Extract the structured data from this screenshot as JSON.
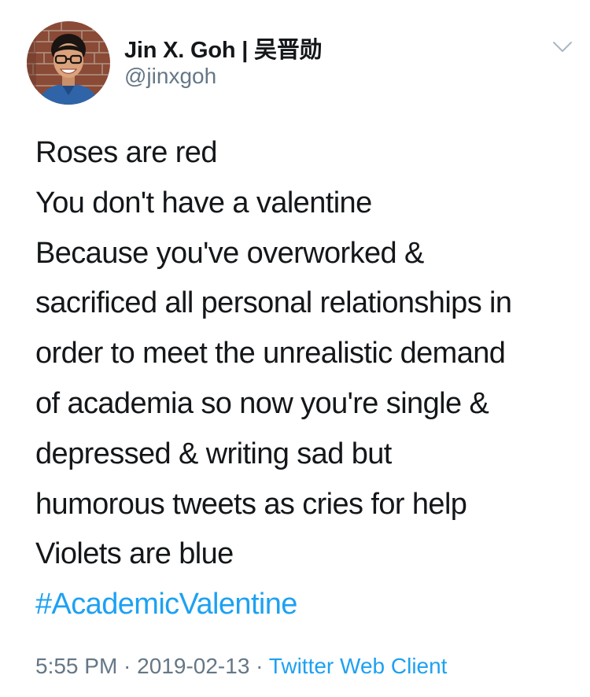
{
  "author": {
    "display_name": "Jin X. Goh | 吴晋勋",
    "handle": "@jinxgoh",
    "avatar_icon": "profile-photo"
  },
  "menu_icon": "chevron-down-icon",
  "tweet": {
    "lines": [
      "Roses are red",
      "You don't have a valentine",
      "Because you've overworked &",
      "sacrificed all personal relationships in",
      "order to meet the unrealistic demand",
      "of academia so now you're single &",
      "depressed & writing sad but",
      "humorous tweets as cries for help",
      "Violets are blue"
    ],
    "hashtag": "#AcademicValentine"
  },
  "meta": {
    "time": "5:55 PM",
    "separator_1": " · ",
    "date": "2019-02-13",
    "separator_2": " · ",
    "source": "Twitter Web Client"
  },
  "colors": {
    "text": "#14171a",
    "secondary": "#657786",
    "link": "#1da1f2"
  }
}
